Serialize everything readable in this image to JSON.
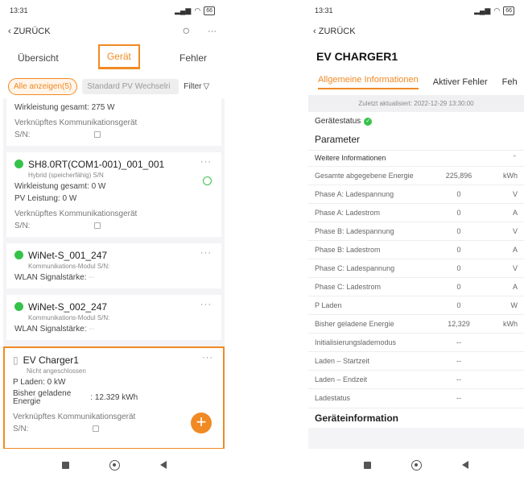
{
  "left": {
    "status_time": "13:31",
    "battery": "66",
    "back_label": "ZURÜCK",
    "tabs": [
      "Übersicht",
      "Gerät",
      "Fehler"
    ],
    "filter_all": "Alle anzeigen(5)",
    "filter_type": "Standard PV Wechselri",
    "filter_label": "Filter",
    "card0": {
      "line1": "Wirkleistung gesamt: 275 W",
      "line2": "Verknüpftes Kommunikationsgerät",
      "line3": "S/N:"
    },
    "card1": {
      "title": "SH8.0RT(COM1-001)_001_001",
      "subtitle": "Hybrid (speicherfähig) S/N",
      "line1": "Wirkleistung gesamt: 0 W",
      "line2": "PV Leistung: 0 W",
      "line3": "Verknüpftes Kommunikationsgerät",
      "line4": "S/N:"
    },
    "card2": {
      "title": "WiNet-S_001_247",
      "subtitle": "Kommunikations-Modul S/N:",
      "line1": "WLAN Signalstärke:",
      "dash": "--"
    },
    "card3": {
      "title": "WiNet-S_002_247",
      "subtitle": "Kommunikations-Modul S/N:",
      "line1": "WLAN Signalstärke:",
      "dash": "--"
    },
    "card4": {
      "title": "EV Charger1",
      "subtitle": "Nicht angeschlossen",
      "line1": "P Laden: 0 kW",
      "line2a": "Bisher geladene",
      "line2b": "Energie",
      "line2v": ": 12.329 kWh",
      "line3": "Verknüpftes Kommunikationsgerät",
      "line4": "S/N:"
    },
    "dots": "···",
    "fab": "+"
  },
  "right": {
    "status_time": "13:31",
    "battery": "66",
    "back_label": "ZURÜCK",
    "title": "EV CHARGER1",
    "tabs": [
      "Allgemeine Informationen",
      "Aktiver Fehler",
      "Feh"
    ],
    "updated": "Zuletzt aktualisiert: 2022-12-29 13:30:00",
    "status_label": "Gerätestatus",
    "param_label": "Parameter",
    "more_label": "Weitere Informationen",
    "rows": [
      {
        "name": "Gesamte abgegebene Energie",
        "value": "225,896",
        "unit": "kWh"
      },
      {
        "name": "Phase A: Ladespannung",
        "value": "0",
        "unit": "V"
      },
      {
        "name": "Phase A: Ladestrom",
        "value": "0",
        "unit": "A"
      },
      {
        "name": "Phase B: Ladespannung",
        "value": "0",
        "unit": "V"
      },
      {
        "name": "Phase B: Ladestrom",
        "value": "0",
        "unit": "A"
      },
      {
        "name": "Phase C: Ladespannung",
        "value": "0",
        "unit": "V"
      },
      {
        "name": "Phase C: Ladestrom",
        "value": "0",
        "unit": "A"
      },
      {
        "name": "P Laden",
        "value": "0",
        "unit": "W"
      },
      {
        "name": "Bisher geladene Energie",
        "value": "12,329",
        "unit": "kWh"
      },
      {
        "name": "Initialisierungslademodus",
        "value": "--",
        "unit": ""
      },
      {
        "name": "Laden – Startzeit",
        "value": "--",
        "unit": ""
      },
      {
        "name": "Laden – Endzeit",
        "value": "--",
        "unit": ""
      },
      {
        "name": "Ladestatus",
        "value": "--",
        "unit": ""
      }
    ],
    "device_info": "Geräteinformation"
  }
}
